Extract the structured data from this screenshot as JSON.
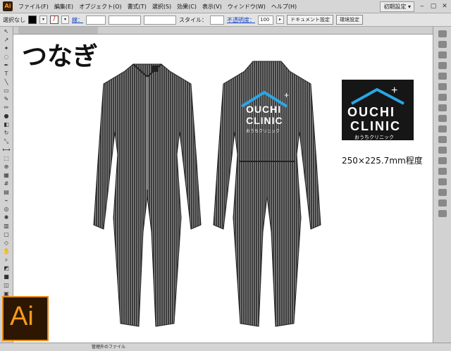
{
  "menu": {
    "app_badge": "Ai",
    "items": [
      "ファイル(F)",
      "編集(E)",
      "オブジェクト(O)",
      "書式(T)",
      "選択(S)",
      "効果(C)",
      "表示(V)",
      "ウィンドウ(W)",
      "ヘルプ(H)"
    ],
    "workspace": "初期設定 ▾"
  },
  "control": {
    "selection": "選択なし",
    "stroke_label": "線：",
    "style_label": "スタイル：",
    "opacity_label": "不透明度：",
    "opacity_value": "100",
    "doc_settings": "ドキュメント設定",
    "env_settings": "環境設定"
  },
  "status": {
    "text": "管理外のファイル"
  },
  "canvas": {
    "title": "つなぎ",
    "logo": {
      "line1": "OUCHI",
      "line2": "CLINIC",
      "sub": "おうちクリニック"
    },
    "caption": "250×225.7mm程度"
  },
  "overlay": {
    "label": "Ai"
  },
  "colors": {
    "garment": "#3e3e3e",
    "logo_blue": "#2aa6e6",
    "ai_orange": "#f79a1d"
  }
}
